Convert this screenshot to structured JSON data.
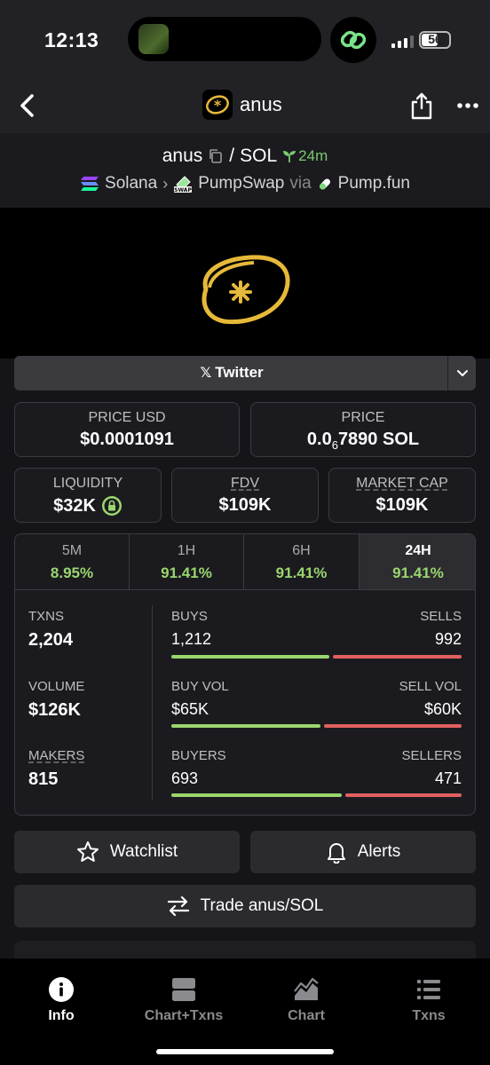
{
  "status_bar": {
    "time": "12:13",
    "battery": "56"
  },
  "nav": {
    "title": "anus",
    "back_icon": "chevron-left-icon",
    "share_icon": "share-icon",
    "more_icon": "more-icon"
  },
  "pair": {
    "base": "anus",
    "separator": "/",
    "quote": "SOL",
    "age": "24m",
    "chain": "Solana",
    "dex": "PumpSwap",
    "via": "via",
    "launchpad": "Pump.fun"
  },
  "twitter": {
    "label": "Twitter"
  },
  "price_usd": {
    "label": "PRICE USD",
    "value": "$0.0001091"
  },
  "price": {
    "label": "PRICE",
    "prefix": "0.0",
    "subscript": "6",
    "digits": "7890 SOL"
  },
  "liquidity": {
    "label": "LIQUIDITY",
    "value": "$32K"
  },
  "fdv": {
    "label": "FDV",
    "value": "$109K"
  },
  "market_cap": {
    "label": "MARKET CAP",
    "value": "$109K"
  },
  "tabs": [
    {
      "label": "5M",
      "value": "8.95%"
    },
    {
      "label": "1H",
      "value": "91.41%"
    },
    {
      "label": "6H",
      "value": "91.41%"
    },
    {
      "label": "24H",
      "value": "91.41%"
    }
  ],
  "metrics": {
    "txns": {
      "label": "TXNS",
      "value": "2,204"
    },
    "volume": {
      "label": "VOLUME",
      "value": "$126K"
    },
    "makers": {
      "label": "MAKERS",
      "value": "815"
    },
    "buys": {
      "label": "BUYS",
      "value": "1,212",
      "ratio": 0.55
    },
    "sells": {
      "label": "SELLS",
      "value": "992"
    },
    "buy_vol": {
      "label": "BUY VOL",
      "value": "$65K",
      "ratio": 0.52
    },
    "sell_vol": {
      "label": "SELL VOL",
      "value": "$60K"
    },
    "buyers": {
      "label": "BUYERS",
      "value": "693",
      "ratio": 0.595
    },
    "sellers": {
      "label": "SELLERS",
      "value": "471"
    }
  },
  "buttons": {
    "watchlist": "Watchlist",
    "alerts": "Alerts",
    "trade": "Trade anus/SOL"
  },
  "tabbar": [
    {
      "label": "Info",
      "icon": "info-icon",
      "active": true
    },
    {
      "label": "Chart+Txns",
      "icon": "split-icon",
      "active": false
    },
    {
      "label": "Chart",
      "icon": "area-chart-icon",
      "active": false
    },
    {
      "label": "Txns",
      "icon": "list-icon",
      "active": false
    }
  ],
  "colors": {
    "accent_green": "#9bd66e",
    "sell_red": "#e26060",
    "logo_yellow": "#e7b93a"
  }
}
